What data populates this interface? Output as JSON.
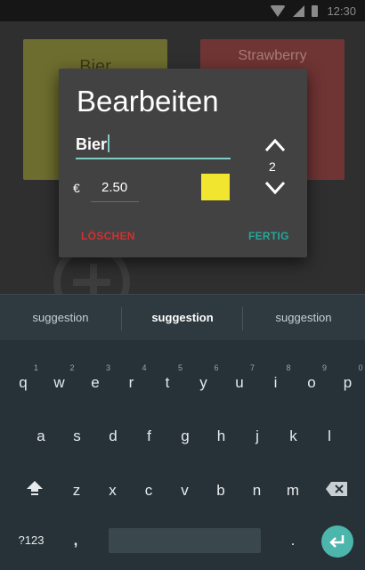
{
  "status_bar": {
    "time": "12:30"
  },
  "background": {
    "tiles": [
      {
        "label": "Bier"
      },
      {
        "label": "Strawberry"
      }
    ]
  },
  "dialog": {
    "title": "Bearbeiten",
    "name_value": "Bier",
    "quantity": "2",
    "currency_symbol": "€",
    "price_value": "2.50",
    "color": "#f2e530",
    "delete_label": "LÖSCHEN",
    "done_label": "FERTIG"
  },
  "keyboard": {
    "suggestions": [
      "suggestion",
      "suggestion",
      "suggestion"
    ],
    "row1": [
      "q",
      "w",
      "e",
      "r",
      "t",
      "y",
      "u",
      "i",
      "o",
      "p"
    ],
    "row1_hints": [
      "1",
      "2",
      "3",
      "4",
      "5",
      "6",
      "7",
      "8",
      "9",
      "0"
    ],
    "row2": [
      "a",
      "s",
      "d",
      "f",
      "g",
      "h",
      "j",
      "k",
      "l"
    ],
    "row3": [
      "z",
      "x",
      "c",
      "v",
      "b",
      "n",
      "m"
    ],
    "symbols_label": "?123",
    "comma": ",",
    "period": "."
  }
}
